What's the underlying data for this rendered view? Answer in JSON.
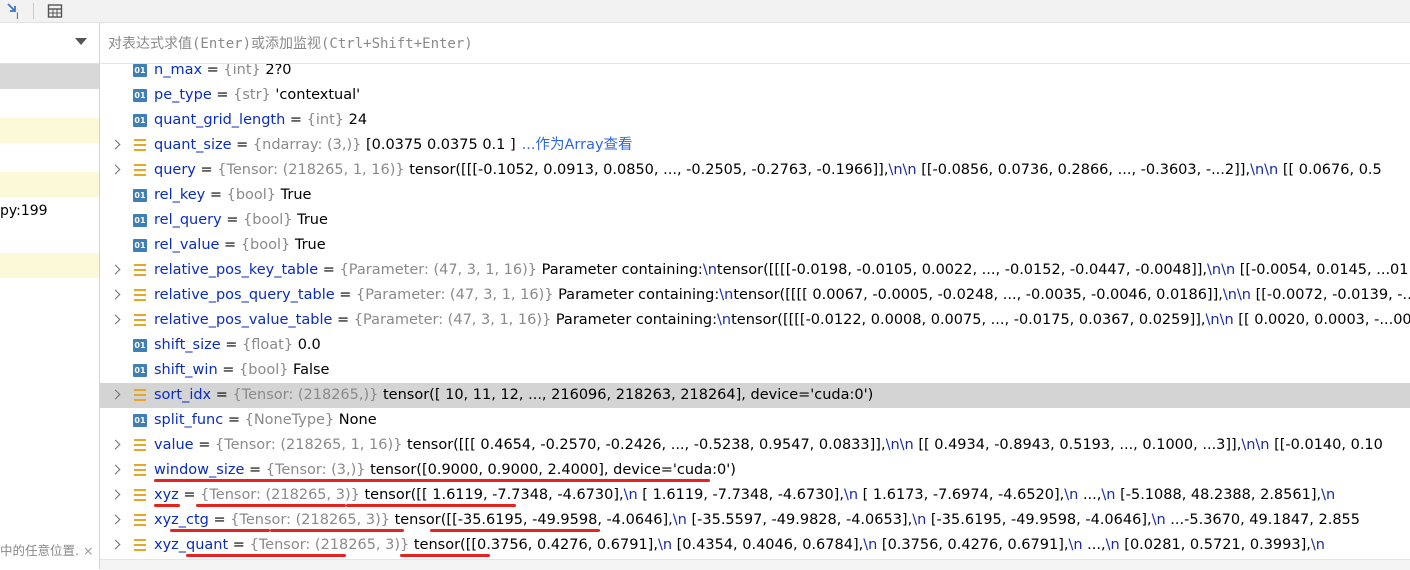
{
  "toolbar": {
    "icons": [
      "step-cursor-icon",
      "table-view-icon"
    ]
  },
  "left_panel": {
    "frames": [
      {
        "text": "",
        "state": "selected"
      },
      {
        "text": "",
        "state": "normal"
      },
      {
        "text": "",
        "state": "highlighted"
      },
      {
        "text": "",
        "state": "normal"
      },
      {
        "text": "",
        "state": "highlighted"
      },
      {
        "text": "py:199",
        "state": "normal"
      },
      {
        "text": "",
        "state": "normal"
      },
      {
        "text": "",
        "state": "highlighted"
      },
      {
        "text": "",
        "state": "normal"
      }
    ],
    "footer_hint": "中的任意位置.",
    "footer_close": "×"
  },
  "evaluate": {
    "placeholder": "对表达式求值(Enter)或添加监视(Ctrl+Shift+Enter)"
  },
  "variables": [
    {
      "icon": "primitive",
      "expandable": false,
      "name": "n_max",
      "type": "{int}",
      "value": " 2?0",
      "cut_top": true
    },
    {
      "icon": "primitive",
      "expandable": false,
      "name": "pe_type",
      "type": "{str}",
      "value": " 'contextual'"
    },
    {
      "icon": "primitive",
      "expandable": false,
      "name": "quant_grid_length",
      "type": "{int}",
      "value": " 24"
    },
    {
      "icon": "object",
      "expandable": true,
      "name": "quant_size",
      "type": "{ndarray: (3,)}",
      "value": " [0.0375 0.0375 0.1   ]",
      "link": "...作为Array查看"
    },
    {
      "icon": "object",
      "expandable": true,
      "name": "query",
      "type": "{Tensor: (218265, 1, 16)}",
      "value": " tensor([[[-0.1052,  0.0913,  0.0850,  ..., -0.2505, -0.2763, -0.1966]],\\n\\n        [[-0.0856,  0.0736,  0.2866,  ..., -0.3603, -...2]],\\n\\n        [[ 0.0676,  0.5"
    },
    {
      "icon": "primitive",
      "expandable": false,
      "name": "rel_key",
      "type": "{bool}",
      "value": " True"
    },
    {
      "icon": "primitive",
      "expandable": false,
      "name": "rel_query",
      "type": "{bool}",
      "value": " True"
    },
    {
      "icon": "primitive",
      "expandable": false,
      "name": "rel_value",
      "type": "{bool}",
      "value": " True"
    },
    {
      "icon": "object",
      "expandable": true,
      "name": "relative_pos_key_table",
      "type": "{Parameter: (47, 3, 1, 16)}",
      "value": " Parameter containing:\\ntensor([[[[-0.0198, -0.0105,  0.0022,  ..., -0.0152, -0.0447, -0.0048]],\\n\\n        [[-0.0054,  0.0145,  ...01"
    },
    {
      "icon": "object",
      "expandable": true,
      "name": "relative_pos_query_table",
      "type": "{Parameter: (47, 3, 1, 16)}",
      "value": " Parameter containing:\\ntensor([[[[ 0.0067, -0.0005, -0.0248,  ..., -0.0035, -0.0046,  0.0186]],\\n\\n        [[-0.0072, -0.0139, -..."
    },
    {
      "icon": "object",
      "expandable": true,
      "name": "relative_pos_value_table",
      "type": "{Parameter: (47, 3, 1, 16)}",
      "value": " Parameter containing:\\ntensor([[[[-0.0122,  0.0008,  0.0075,  ..., -0.0175,  0.0367,  0.0259]],\\n\\n        [[ 0.0020,  0.0003, -...00"
    },
    {
      "icon": "primitive",
      "expandable": false,
      "name": "shift_size",
      "type": "{float}",
      "value": " 0.0"
    },
    {
      "icon": "primitive",
      "expandable": false,
      "name": "shift_win",
      "type": "{bool}",
      "value": " False"
    },
    {
      "icon": "object",
      "expandable": true,
      "name": "sort_idx",
      "type": "{Tensor: (218265,)}",
      "value": " tensor([    10,     11,     12,  ..., 216096, 218263, 218264], device='cuda:0')",
      "selected": true
    },
    {
      "icon": "primitive",
      "expandable": false,
      "name": "split_func",
      "type": "{NoneType}",
      "value": " None"
    },
    {
      "icon": "object",
      "expandable": true,
      "name": "value",
      "type": "{Tensor: (218265, 1, 16)}",
      "value": " tensor([[[ 0.4654, -0.2570, -0.2426,  ..., -0.5238,  0.9547,  0.0833]],\\n\\n        [[ 0.4934, -0.8943,  0.5193,  ...,  0.1000,  ...3]],\\n\\n        [[-0.0140,  0.10"
    },
    {
      "icon": "object",
      "expandable": true,
      "name": "window_size",
      "type": "{Tensor: (3,)}",
      "value": " tensor([0.9000, 0.9000, 2.4000], device='cuda:0')",
      "underlined": true
    },
    {
      "icon": "object",
      "expandable": true,
      "name": "xyz",
      "type": "{Tensor: (218265, 3)}",
      "value": " tensor([[ 1.6119, -7.7348, -4.6730],\\n        [ 1.6119, -7.7348, -4.6730],\\n        [ 1.6173, -7.6974, -4.6520],\\n        ...,\\n        [-5.1088, 48.2388,  2.8561],\\n",
      "underlined": true
    },
    {
      "icon": "object",
      "expandable": true,
      "name": "xyz_ctg",
      "type": "{Tensor: (218265, 3)}",
      "value": " tensor([[-35.6195, -49.9598,  -4.0646],\\n        [-35.5597, -49.9828,  -4.0653],\\n        [-35.6195, -49.9598,  -4.0646],\\n        ...-5.3670,  49.1847,   2.855",
      "underlined": true
    },
    {
      "icon": "object",
      "expandable": true,
      "name": "xyz_quant",
      "type": "{Tensor: (218265, 3)}",
      "value": " tensor([[0.3756, 0.4276, 0.6791],\\n        [0.4354, 0.4046, 0.6784],\\n        [0.3756, 0.4276, 0.6791],\\n        ...,\\n        [0.0281, 0.5721, 0.3993],\\n",
      "underlined": true
    }
  ],
  "colors": {
    "name": "#0a2cbf",
    "type": "#8a8a8a",
    "link": "#2f68d8",
    "selected_row": "#d4d4d4",
    "annotation": "#e52421",
    "primitive_icon": "#3f7fb3",
    "object_icon": "#e8a526"
  }
}
